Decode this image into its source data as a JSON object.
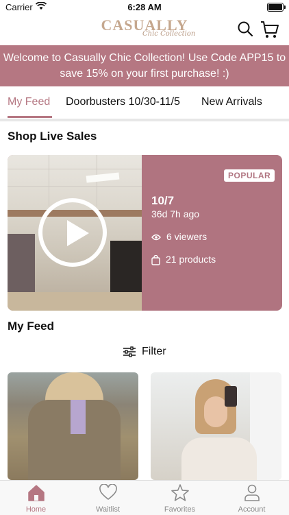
{
  "status_bar": {
    "carrier": "Carrier",
    "time": "6:28 AM"
  },
  "header": {
    "logo_main": "CASUALLY",
    "logo_sub": "Chic Collection"
  },
  "banner": {
    "text": "Welcome to Casually Chic Collection! Use Code APP15 to save 15% on your first purchase! :)"
  },
  "tabs": [
    {
      "label": "My Feed",
      "active": true
    },
    {
      "label": "Doorbusters 10/30-11/5",
      "active": false
    },
    {
      "label": "New Arrivals",
      "active": false
    }
  ],
  "live_sales": {
    "title": "Shop Live Sales",
    "card": {
      "badge": "POPULAR",
      "date": "10/7",
      "ago": "36d 7h ago",
      "viewers": "6 viewers",
      "products": "21 products"
    }
  },
  "feed": {
    "title": "My Feed",
    "filter_label": "Filter"
  },
  "bottom_nav": [
    {
      "label": "Home",
      "icon": "home-icon",
      "active": true
    },
    {
      "label": "Waitlist",
      "icon": "heart-icon",
      "active": false
    },
    {
      "label": "Favorites",
      "icon": "star-icon",
      "active": false
    },
    {
      "label": "Account",
      "icon": "person-icon",
      "active": false
    }
  ],
  "colors": {
    "accent": "#b57782",
    "card": "#b07480",
    "logo": "#c5a78e"
  }
}
